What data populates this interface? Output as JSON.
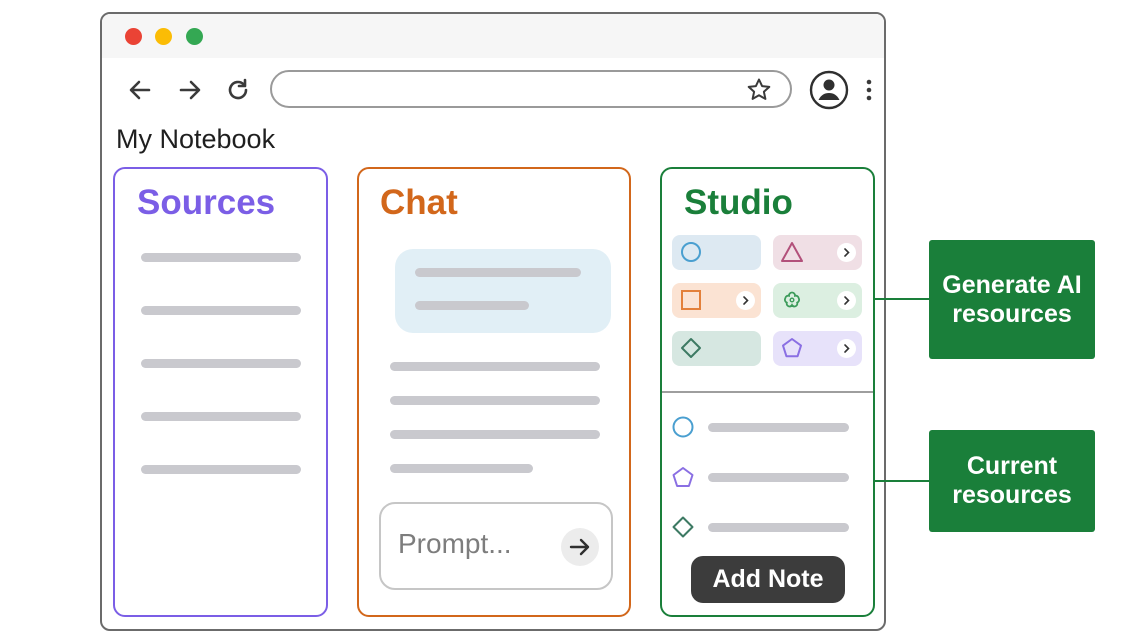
{
  "notebook": {
    "title": "My Notebook"
  },
  "panels": {
    "sources": {
      "title": "Sources",
      "color": "#7b5ee6"
    },
    "chat": {
      "title": "Chat",
      "color": "#d2671b",
      "prompt_placeholder": "Prompt..."
    },
    "studio": {
      "title": "Studio",
      "color": "#1a7f3a",
      "add_note_label": "Add Note"
    }
  },
  "studio_tiles": [
    {
      "icon": "circle-icon",
      "color": "#4a9fd0",
      "bg": "#dde9f2",
      "chevron": false
    },
    {
      "icon": "triangle-icon",
      "color": "#b2507a",
      "bg": "#f0dfe5",
      "chevron": true
    },
    {
      "icon": "square-icon",
      "color": "#e3803a",
      "bg": "#fbe3d3",
      "chevron": true
    },
    {
      "icon": "flower-icon",
      "color": "#3c9b5a",
      "bg": "#dcefe1",
      "chevron": true
    },
    {
      "icon": "diamond-icon",
      "color": "#3d7a63",
      "bg": "#d6e7e1",
      "chevron": false
    },
    {
      "icon": "pentagon-icon",
      "color": "#8a6fe3",
      "bg": "#e7e2fa",
      "chevron": true
    }
  ],
  "current_resources": [
    {
      "icon": "circle-icon",
      "color": "#4a9fd0"
    },
    {
      "icon": "pentagon-icon",
      "color": "#8a6fe3"
    },
    {
      "icon": "diamond-icon",
      "color": "#3d7a63"
    }
  ],
  "callouts": {
    "generate": "Generate AI resources",
    "current": "Current resources"
  },
  "colors": {
    "window_border": "#6b6b6b",
    "placeholder_line": "#c9c9ce",
    "callout_bg": "#1a7f3a",
    "traffic_lights": [
      "#ea4335",
      "#fbbc05",
      "#34a853"
    ]
  }
}
